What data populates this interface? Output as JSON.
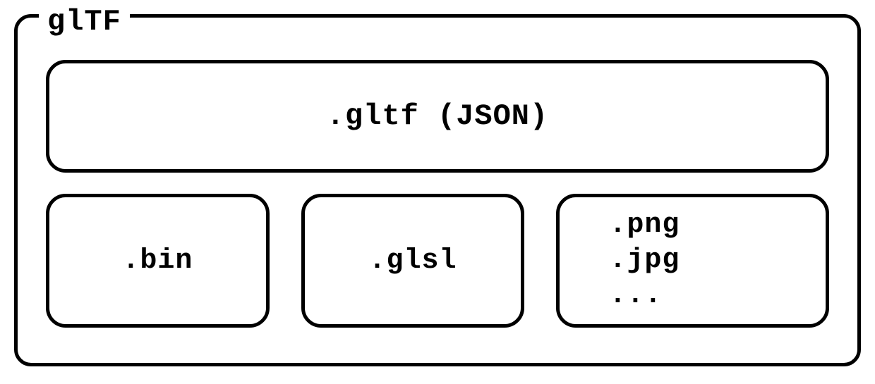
{
  "title": "glTF",
  "top_file": ".gltf (JSON)",
  "bottom_files": {
    "bin": ".bin",
    "glsl": ".glsl",
    "images": [
      ".png",
      ".jpg",
      "..."
    ]
  }
}
